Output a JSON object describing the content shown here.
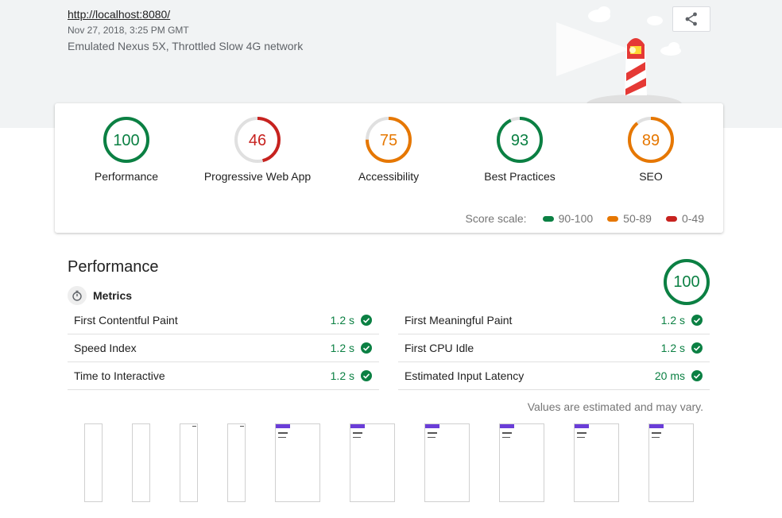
{
  "header": {
    "url": "http://localhost:8080/",
    "date": "Nov 27, 2018, 3:25 PM GMT",
    "environment": "Emulated Nexus 5X, Throttled Slow 4G network",
    "share_icon": "share-icon"
  },
  "colors": {
    "pass": "#0b8043",
    "average": "#e67700",
    "fail": "#c7221f",
    "track": "#e0e0e0"
  },
  "categories": [
    {
      "label": "Performance",
      "score": "100",
      "value": 100,
      "color": "#0b8043"
    },
    {
      "label": "Progressive Web App",
      "score": "46",
      "value": 46,
      "color": "#c7221f"
    },
    {
      "label": "Accessibility",
      "score": "75",
      "value": 75,
      "color": "#e67700"
    },
    {
      "label": "Best Practices",
      "score": "93",
      "value": 93,
      "color": "#0b8043"
    },
    {
      "label": "SEO",
      "score": "89",
      "value": 89,
      "color": "#e67700"
    }
  ],
  "scale": {
    "label": "Score scale:",
    "ranges": [
      {
        "label": "90-100",
        "color": "#0b8043"
      },
      {
        "label": "50-89",
        "color": "#e67700"
      },
      {
        "label": "0-49",
        "color": "#c7221f"
      }
    ]
  },
  "performance": {
    "title": "Performance",
    "score": "100",
    "value": 100,
    "metrics_title": "Metrics",
    "metrics_icon": "stopwatch-icon",
    "metrics": [
      {
        "name": "First Contentful Paint",
        "value": "1.2 s"
      },
      {
        "name": "First Meaningful Paint",
        "value": "1.2 s"
      },
      {
        "name": "Speed Index",
        "value": "1.2 s"
      },
      {
        "name": "First CPU Idle",
        "value": "1.2 s"
      },
      {
        "name": "Time to Interactive",
        "value": "1.2 s"
      },
      {
        "name": "Estimated Input Latency",
        "value": "20 ms"
      }
    ],
    "note": "Values are estimated and may vary."
  }
}
